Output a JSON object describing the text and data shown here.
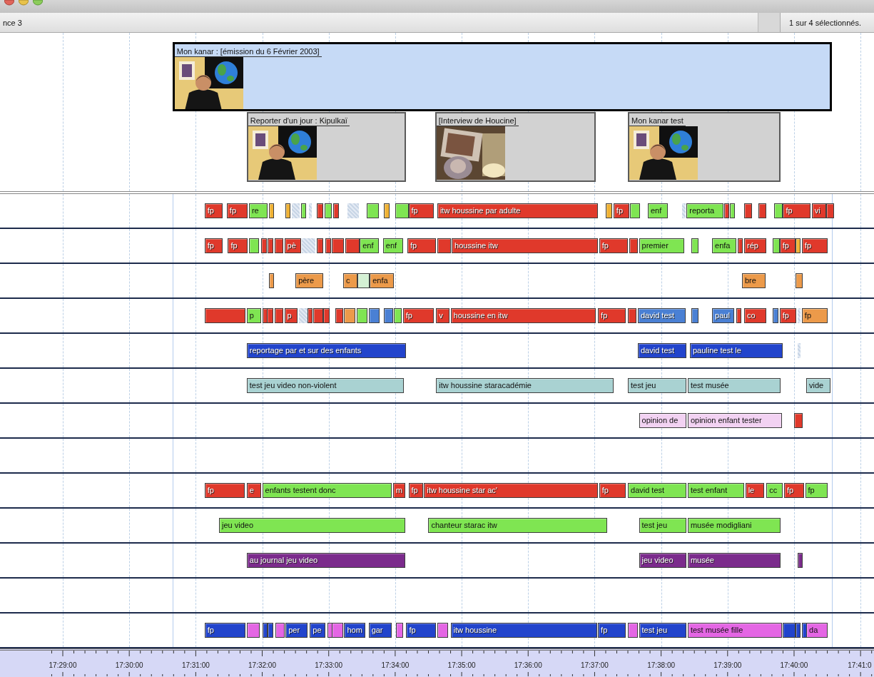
{
  "toolbar": {
    "left_text": "nce 3",
    "selection_status": "1 sur 4 sélectionnés."
  },
  "video": {
    "clips": [
      {
        "title": "Mon kanar : [émission du 6 Février 2003]",
        "selected": true,
        "thumbnail": {
          "kind": "picture"
        },
        "children": [
          {
            "title": "Reporter d'un jour : Kipulkaï",
            "selected": false,
            "thumbnail": {
              "kind": "picture"
            }
          },
          {
            "title": "[Interview de Houcine]",
            "selected": false,
            "thumbnail": {
              "kind": "picture"
            }
          },
          {
            "title": "Mon kanar test",
            "selected": false,
            "thumbnail": {
              "kind": "picture"
            }
          }
        ]
      }
    ]
  },
  "tracks": [
    {
      "clips": [
        {
          "kind": "clip",
          "color": "#e0392b",
          "label": "fp"
        },
        {
          "kind": "clip",
          "color": "#e0392b",
          "label": "fp"
        },
        {
          "kind": "clip",
          "color": "#7fe552",
          "label": "re"
        },
        {
          "kind": "clip",
          "color": "#f0b234"
        },
        {
          "kind": "clip",
          "color": "#f0b234"
        },
        {
          "kind": "ghost"
        },
        {
          "kind": "clip",
          "color": "#7fe552"
        },
        {
          "kind": "ghost"
        },
        {
          "kind": "clip",
          "color": "#e0392b"
        },
        {
          "kind": "clip",
          "color": "#7fe552"
        },
        {
          "kind": "clip",
          "color": "#e0392b"
        },
        {
          "kind": "ghost"
        },
        {
          "kind": "clip",
          "color": "#7fe552"
        },
        {
          "kind": "clip",
          "color": "#f0b234"
        },
        {
          "kind": "clip",
          "color": "#7fe552"
        },
        {
          "kind": "clip",
          "color": "#e0392b",
          "label": "fp"
        },
        {
          "kind": "clip",
          "color": "#e0392b",
          "label": "itw houssine par adulte"
        },
        {
          "kind": "clip",
          "color": "#f0b234"
        },
        {
          "kind": "clip",
          "color": "#e0392b",
          "label": "fp"
        },
        {
          "kind": "clip",
          "color": "#7fe552"
        },
        {
          "kind": "clip",
          "color": "#7fe552",
          "label": "enf"
        },
        {
          "kind": "ghost"
        },
        {
          "kind": "clip",
          "color": "#7fe552",
          "label": "reporta"
        },
        {
          "kind": "clip",
          "color": "#e0392b"
        },
        {
          "kind": "clip",
          "color": "#7fe552"
        },
        {
          "kind": "clip",
          "color": "#e0392b"
        },
        {
          "kind": "clip",
          "color": "#e0392b"
        },
        {
          "kind": "clip",
          "color": "#7fe552"
        },
        {
          "kind": "clip",
          "color": "#e0392b",
          "label": "fp"
        },
        {
          "kind": "clip",
          "color": "#e0392b",
          "label": "vi"
        },
        {
          "kind": "clip",
          "color": "#e0392b"
        }
      ]
    },
    {
      "clips": [
        {
          "kind": "clip",
          "color": "#e0392b",
          "label": "fp"
        },
        {
          "kind": "clip",
          "color": "#e0392b",
          "label": "fp"
        },
        {
          "kind": "clip",
          "color": "#7fe552"
        },
        {
          "kind": "clip",
          "color": "#e0392b"
        },
        {
          "kind": "clip",
          "color": "#e0392b"
        },
        {
          "kind": "clip",
          "color": "#e0392b"
        },
        {
          "kind": "clip",
          "color": "#e0392b",
          "label": "pè"
        },
        {
          "kind": "ghost"
        },
        {
          "kind": "clip",
          "color": "#e0392b"
        },
        {
          "kind": "clip",
          "color": "#e0392b"
        },
        {
          "kind": "clip",
          "color": "#e0392b"
        },
        {
          "kind": "clip",
          "color": "#e0392b"
        },
        {
          "kind": "clip",
          "color": "#7fe552",
          "label": "enf"
        },
        {
          "kind": "clip",
          "color": "#7fe552",
          "label": "enf"
        },
        {
          "kind": "clip",
          "color": "#e0392b",
          "label": "fp"
        },
        {
          "kind": "clip",
          "color": "#e0392b"
        },
        {
          "kind": "clip",
          "color": "#e0392b",
          "label": "houssine itw"
        },
        {
          "kind": "clip",
          "color": "#e0392b",
          "label": "fp"
        },
        {
          "kind": "clip",
          "color": "#e0392b"
        },
        {
          "kind": "clip",
          "color": "#7fe552",
          "label": "premier"
        },
        {
          "kind": "clip",
          "color": "#7fe552"
        },
        {
          "kind": "clip",
          "color": "#7fe552",
          "label": "enfa"
        },
        {
          "kind": "clip",
          "color": "#e0392b"
        },
        {
          "kind": "clip",
          "color": "#e0392b",
          "label": "rép"
        },
        {
          "kind": "clip",
          "color": "#7fe552"
        },
        {
          "kind": "clip",
          "color": "#e0392b",
          "label": "fp"
        },
        {
          "kind": "clip",
          "color": "#f0b234"
        },
        {
          "kind": "clip",
          "color": "#e0392b",
          "label": "fp"
        }
      ]
    },
    {
      "clips": [
        {
          "kind": "clip",
          "color": "#ec9a4a"
        },
        {
          "kind": "clip",
          "color": "#ec9a4a",
          "label": "père"
        },
        {
          "kind": "clip",
          "color": "#ec9a4a",
          "label": "c"
        },
        {
          "kind": "clip",
          "color": "#d4f0d4"
        },
        {
          "kind": "clip",
          "color": "#ec9a4a",
          "label": "enfa"
        },
        {
          "kind": "clip",
          "color": "#ec9a4a",
          "label": "bre"
        },
        {
          "kind": "clip",
          "color": "#ec9a4a"
        }
      ]
    },
    {
      "clips": [
        {
          "kind": "clip",
          "color": "#e0392b"
        },
        {
          "kind": "clip",
          "color": "#7fe552",
          "label": "p"
        },
        {
          "kind": "clip",
          "color": "#e0392b"
        },
        {
          "kind": "clip",
          "color": "#e0392b"
        },
        {
          "kind": "clip",
          "color": "#e0392b"
        },
        {
          "kind": "clip",
          "color": "#e0392b",
          "label": "p"
        },
        {
          "kind": "ghost"
        },
        {
          "kind": "clip",
          "color": "#e0392b"
        },
        {
          "kind": "clip",
          "color": "#e0392b"
        },
        {
          "kind": "clip",
          "color": "#e0392b"
        },
        {
          "kind": "clip",
          "color": "#e0392b"
        },
        {
          "kind": "clip",
          "color": "#ec9a4a"
        },
        {
          "kind": "clip",
          "color": "#7fe552"
        },
        {
          "kind": "clip",
          "color": "#4a80d4"
        },
        {
          "kind": "clip",
          "color": "#4a80d4"
        },
        {
          "kind": "clip",
          "color": "#7fe552"
        },
        {
          "kind": "clip",
          "color": "#e0392b",
          "label": "fp"
        },
        {
          "kind": "clip",
          "color": "#e0392b",
          "label": "v"
        },
        {
          "kind": "clip",
          "color": "#e0392b",
          "label": "houssine en itw"
        },
        {
          "kind": "clip",
          "color": "#e0392b",
          "label": "fp"
        },
        {
          "kind": "clip",
          "color": "#e0392b"
        },
        {
          "kind": "clip",
          "color": "#4a80d4",
          "label": "david test"
        },
        {
          "kind": "clip",
          "color": "#4a80d4"
        },
        {
          "kind": "clip",
          "color": "#4a80d4",
          "label": "paul"
        },
        {
          "kind": "clip",
          "color": "#e0392b"
        },
        {
          "kind": "clip",
          "color": "#e0392b",
          "label": "co"
        },
        {
          "kind": "clip",
          "color": "#4a80d4"
        },
        {
          "kind": "clip",
          "color": "#e0392b",
          "label": "fp"
        },
        {
          "kind": "ghost"
        },
        {
          "kind": "clip",
          "color": "#ec9a4a",
          "label": "fp"
        }
      ]
    },
    {
      "clips": [
        {
          "kind": "clip",
          "color": "#2244cc",
          "label": "reportage par et sur des enfants"
        },
        {
          "kind": "clip",
          "color": "#2244cc",
          "label": "david test"
        },
        {
          "kind": "clip",
          "color": "#2244cc",
          "label": "pauline test le"
        },
        {
          "kind": "ghost"
        }
      ]
    },
    {
      "clips": [
        {
          "kind": "clip",
          "color": "#a9d2d2",
          "label": "test jeu video non-violent"
        },
        {
          "kind": "clip",
          "color": "#a9d2d2",
          "label": "itw houssine staracadémie"
        },
        {
          "kind": "clip",
          "color": "#a9d2d2",
          "label": "test jeu"
        },
        {
          "kind": "clip",
          "color": "#a9d2d2",
          "label": "test musée"
        },
        {
          "kind": "clip",
          "color": "#a9d2d2",
          "label": "vide"
        }
      ]
    },
    {
      "clips": [
        {
          "kind": "clip",
          "color": "#f2d2f2",
          "label": "opinion de"
        },
        {
          "kind": "clip",
          "color": "#f2d2f2",
          "label": "opinion enfant tester"
        },
        {
          "kind": "clip",
          "color": "#e0392b"
        }
      ]
    },
    {
      "clips": [
        {
          "kind": "clip",
          "color": "#e0392b",
          "label": "fp"
        },
        {
          "kind": "clip",
          "color": "#e0392b",
          "label": "e"
        },
        {
          "kind": "clip",
          "color": "#7fe552",
          "label": "enfants testent donc"
        },
        {
          "kind": "clip",
          "color": "#e0392b",
          "label": "m"
        },
        {
          "kind": "clip",
          "color": "#e0392b",
          "label": "fp"
        },
        {
          "kind": "clip",
          "color": "#e0392b",
          "label": "itw houssine star ac'"
        },
        {
          "kind": "clip",
          "color": "#e0392b",
          "label": "fp"
        },
        {
          "kind": "clip",
          "color": "#7fe552",
          "label": "david test"
        },
        {
          "kind": "clip",
          "color": "#7fe552",
          "label": "test enfant"
        },
        {
          "kind": "clip",
          "color": "#e0392b",
          "label": "le"
        },
        {
          "kind": "clip",
          "color": "#7fe552",
          "label": "cc"
        },
        {
          "kind": "clip",
          "color": "#e0392b",
          "label": "fp"
        },
        {
          "kind": "clip",
          "color": "#7fe552",
          "label": "fp"
        }
      ]
    },
    {
      "clips": [
        {
          "kind": "clip",
          "color": "#7fe552",
          "label": "jeu video"
        },
        {
          "kind": "clip",
          "color": "#7fe552",
          "label": "chanteur starac itw"
        },
        {
          "kind": "clip",
          "color": "#7fe552",
          "label": "test jeu"
        },
        {
          "kind": "clip",
          "color": "#7fe552",
          "label": "musée modigliani"
        }
      ]
    },
    {
      "clips": [
        {
          "kind": "clip",
          "color": "#7b2b8c",
          "label": "au journal jeu video"
        },
        {
          "kind": "clip",
          "color": "#7b2b8c",
          "label": "jeu video"
        },
        {
          "kind": "clip",
          "color": "#7b2b8c",
          "label": "musée"
        },
        {
          "kind": "clip",
          "color": "#7b2b8c"
        }
      ]
    },
    {
      "clips": [
        {
          "kind": "clip",
          "color": "#2244cc",
          "label": "fp"
        },
        {
          "kind": "clip",
          "color": "#e466e4"
        },
        {
          "kind": "clip",
          "color": "#2244cc"
        },
        {
          "kind": "clip",
          "color": "#2244cc"
        },
        {
          "kind": "clip",
          "color": "#e466e4"
        },
        {
          "kind": "clip",
          "color": "#2244cc",
          "label": "per"
        },
        {
          "kind": "clip",
          "color": "#2244cc",
          "label": "pe"
        },
        {
          "kind": "clip",
          "color": "#e466e4"
        },
        {
          "kind": "clip",
          "color": "#e466e4"
        },
        {
          "kind": "clip",
          "color": "#2244cc",
          "label": "hom"
        },
        {
          "kind": "clip",
          "color": "#2244cc",
          "label": "gar"
        },
        {
          "kind": "clip",
          "color": "#e466e4"
        },
        {
          "kind": "clip",
          "color": "#2244cc",
          "label": "fp"
        },
        {
          "kind": "clip",
          "color": "#e466e4"
        },
        {
          "kind": "clip",
          "color": "#2244cc",
          "label": "itw houssine"
        },
        {
          "kind": "clip",
          "color": "#2244cc",
          "label": "fp"
        },
        {
          "kind": "clip",
          "color": "#e466e4"
        },
        {
          "kind": "clip",
          "color": "#2244cc",
          "label": "test jeu"
        },
        {
          "kind": "clip",
          "color": "#e466e4",
          "label": "test musée fille"
        },
        {
          "kind": "clip",
          "color": "#2244cc"
        },
        {
          "kind": "clip",
          "color": "#2244cc"
        },
        {
          "kind": "clip",
          "color": "#2244cc"
        },
        {
          "kind": "clip",
          "color": "#e466e4",
          "label": "da"
        }
      ]
    }
  ],
  "ruler": {
    "ticks": [
      {
        "label": "17:29:00"
      },
      {
        "label": "17:30:00"
      },
      {
        "label": "17:31:00"
      },
      {
        "label": "17:32:00"
      },
      {
        "label": "17:33:00"
      },
      {
        "label": "17:34:00"
      },
      {
        "label": "17:35:00"
      },
      {
        "label": "17:36:00"
      },
      {
        "label": "17:37:00"
      },
      {
        "label": "17:38:00"
      },
      {
        "label": "17:39:00"
      },
      {
        "label": "17:40:00"
      },
      {
        "label": "17:41:0"
      }
    ]
  }
}
